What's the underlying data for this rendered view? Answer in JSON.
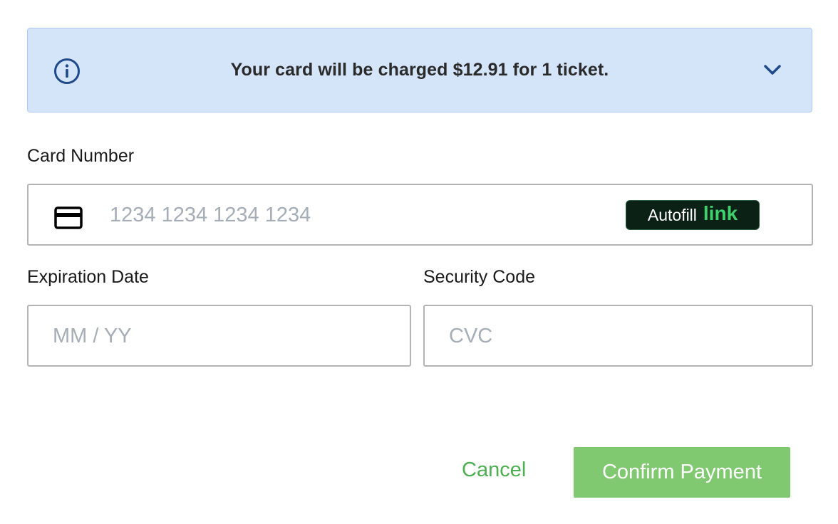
{
  "banner": {
    "message": "Your card will be charged $12.91 for 1 ticket.",
    "info_icon": "info-circle-icon",
    "expand_icon": "chevron-down-icon",
    "background_color": "#d4e4f9",
    "icon_color": "#1f4a8a"
  },
  "card_number": {
    "label": "Card Number",
    "placeholder": "1234 1234 1234 1234",
    "value": "",
    "icon": "credit-card-icon",
    "autofill": {
      "label": "Autofill",
      "brand": "link"
    }
  },
  "expiration": {
    "label": "Expiration Date",
    "placeholder": "MM / YY",
    "value": ""
  },
  "security_code": {
    "label": "Security Code",
    "placeholder": "CVC",
    "value": ""
  },
  "actions": {
    "cancel_label": "Cancel",
    "confirm_label": "Confirm Payment",
    "accent_color": "#4caf50",
    "confirm_color": "#80c971"
  }
}
